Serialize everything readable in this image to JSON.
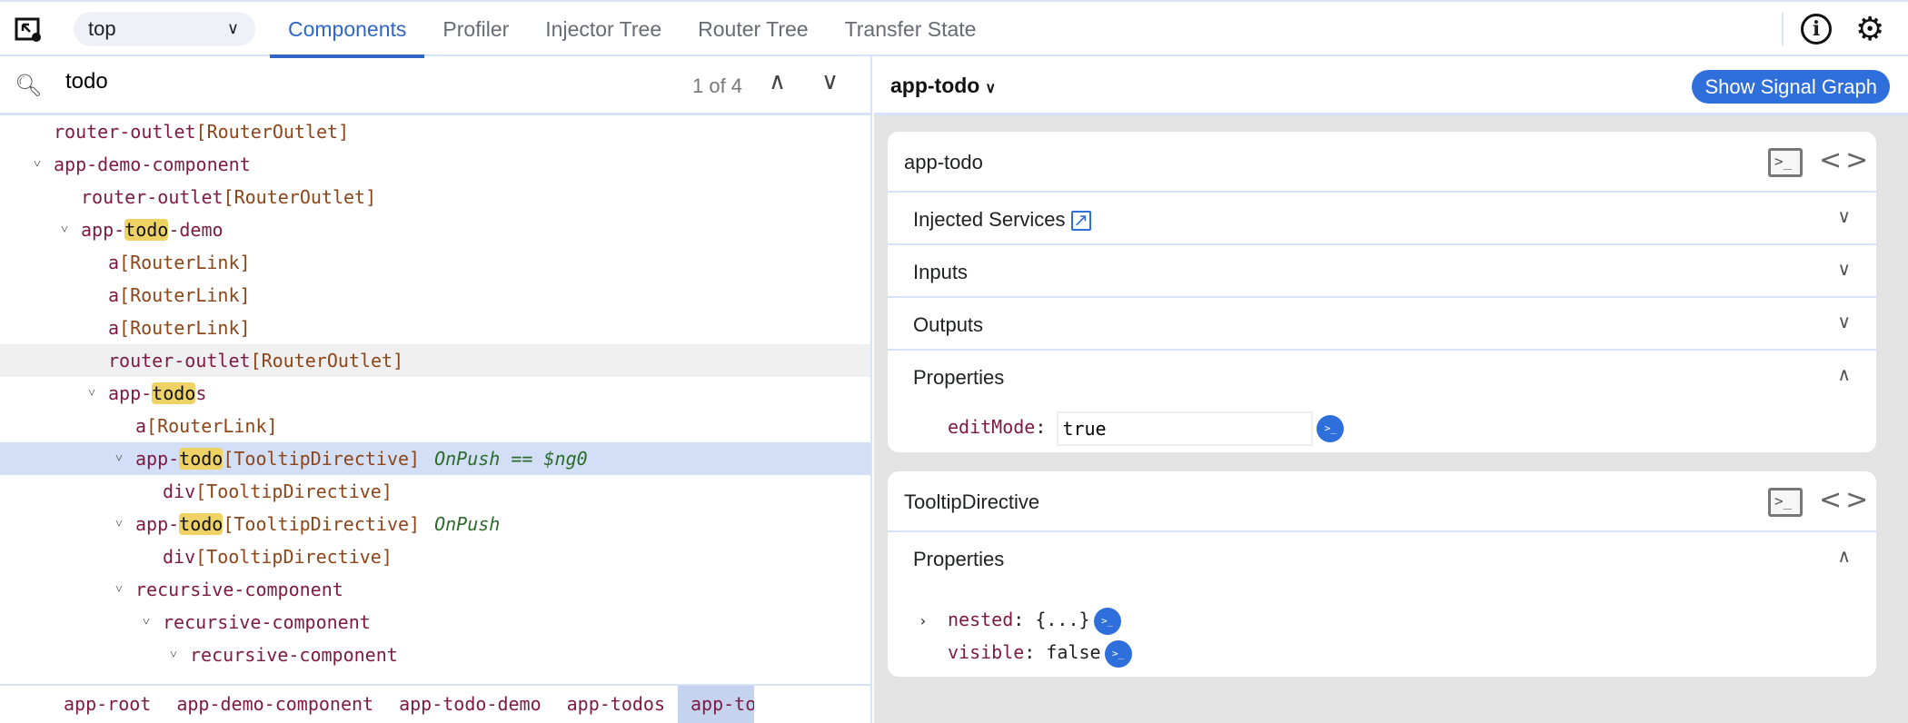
{
  "topbar": {
    "frame_select": "top",
    "tabs": [
      "Components",
      "Profiler",
      "Injector Tree",
      "Router Tree",
      "Transfer State"
    ],
    "active_tab": "Components",
    "icons": [
      "element-picker-icon",
      "info-icon",
      "gear-icon"
    ]
  },
  "search": {
    "value": "todo",
    "count": "1 of 4"
  },
  "tree": {
    "query": "todo",
    "rows": [
      {
        "depth": 0,
        "expandable": false,
        "tag": "router-outlet",
        "directives": "[RouterOutlet]"
      },
      {
        "depth": 0,
        "expandable": true,
        "tag": "app-demo-component",
        "directives": ""
      },
      {
        "depth": 1,
        "expandable": false,
        "tag": "router-outlet",
        "directives": "[RouterOutlet]"
      },
      {
        "depth": 1,
        "expandable": true,
        "tag": "app-todo-demo",
        "directives": ""
      },
      {
        "depth": 2,
        "expandable": false,
        "tag": "a",
        "directives": "[RouterLink]"
      },
      {
        "depth": 2,
        "expandable": false,
        "tag": "a",
        "directives": "[RouterLink]"
      },
      {
        "depth": 2,
        "expandable": false,
        "tag": "a",
        "directives": "[RouterLink]"
      },
      {
        "depth": 2,
        "expandable": false,
        "tag": "router-outlet",
        "directives": "[RouterOutlet]",
        "state": "hover"
      },
      {
        "depth": 2,
        "expandable": true,
        "tag": "app-todos",
        "directives": ""
      },
      {
        "depth": 3,
        "expandable": false,
        "tag": "a",
        "directives": "[RouterLink]"
      },
      {
        "depth": 3,
        "expandable": true,
        "tag": "app-todo",
        "directives": "[TooltipDirective]",
        "annotation": "OnPush == $ng0",
        "state": "selected"
      },
      {
        "depth": 4,
        "expandable": false,
        "tag": "div",
        "directives": "[TooltipDirective]"
      },
      {
        "depth": 3,
        "expandable": true,
        "tag": "app-todo",
        "directives": "[TooltipDirective]",
        "annotation": "OnPush"
      },
      {
        "depth": 4,
        "expandable": false,
        "tag": "div",
        "directives": "[TooltipDirective]"
      },
      {
        "depth": 3,
        "expandable": true,
        "tag": "recursive-component",
        "directives": ""
      },
      {
        "depth": 4,
        "expandable": true,
        "tag": "recursive-component",
        "directives": ""
      },
      {
        "depth": 5,
        "expandable": true,
        "tag": "recursive-component",
        "directives": ""
      }
    ]
  },
  "breadcrumbs": [
    "app-root",
    "app-demo-component",
    "app-todo-demo",
    "app-todos",
    "app-todo"
  ],
  "details": {
    "title": "app-todo",
    "signal_graph_button": "Show Signal Graph",
    "cards": [
      {
        "name": "app-todo",
        "sections": [
          {
            "label": "Injected Services",
            "expanded": false,
            "external_link": true
          },
          {
            "label": "Inputs",
            "expanded": false
          },
          {
            "label": "Outputs",
            "expanded": false
          },
          {
            "label": "Properties",
            "expanded": true
          }
        ],
        "properties": [
          {
            "key": "editMode",
            "value": "true",
            "editable": true
          }
        ]
      },
      {
        "name": "TooltipDirective",
        "sections": [
          {
            "label": "Properties",
            "expanded": true
          }
        ],
        "properties": [
          {
            "key": "nested",
            "value": "{...}",
            "expandable": true
          },
          {
            "key": "visible",
            "value": "false"
          }
        ]
      }
    ]
  },
  "colors": {
    "accent": "#2f66c7",
    "button": "#2f6fdb",
    "tag": "#7d1a42",
    "directive": "#8c4518",
    "onpush": "#2c6b2c",
    "highlight": "#efd264",
    "selected_row": "#d2dff6"
  }
}
